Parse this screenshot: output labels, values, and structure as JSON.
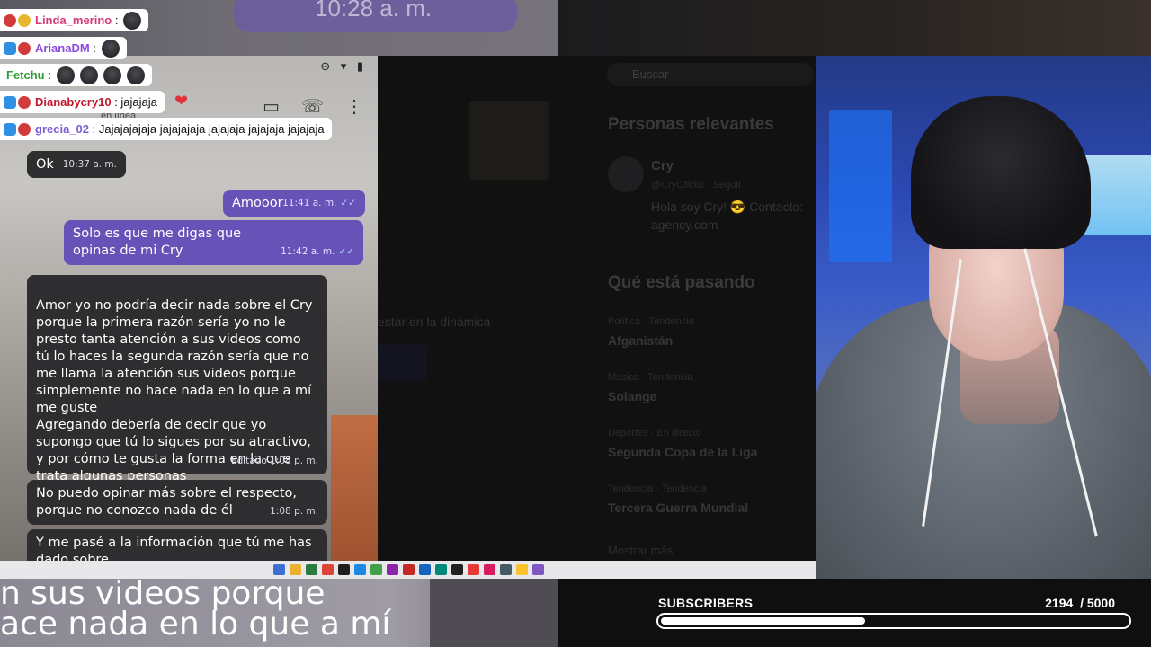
{
  "chat": [
    {
      "badges": [
        "red",
        "gold"
      ],
      "user": "Linda_merino",
      "color": "#d43a7a",
      "message": "",
      "emotes": 1
    },
    {
      "badges": [
        "blue",
        "red"
      ],
      "user": "ArianaDM",
      "color": "#8a4be0",
      "message": "",
      "emotes": 1
    },
    {
      "badges": [],
      "user": "Fetchu",
      "color": "#2e9d3a",
      "message": "",
      "emotes": 4
    },
    {
      "badges": [
        "blue",
        "red"
      ],
      "user": "Dianabycry10",
      "color": "#c0182e",
      "message": "jajajaja",
      "emotes": 0
    },
    {
      "badges": [
        "blue",
        "red"
      ],
      "user": "grecia_02",
      "color": "#7a5bd6",
      "message": "Jajajajajaja jajajajaja jajajaja jajajaja jajajaja",
      "emotes": 0
    }
  ],
  "phone": {
    "status_online": "en línea",
    "messages": [
      {
        "dir": "in",
        "text": "Ok",
        "time": "10:37 a. m."
      },
      {
        "dir": "out",
        "text": "Amooor",
        "time": "11:41 a. m."
      },
      {
        "dir": "out",
        "text": "Solo es que me digas que opinas de mi Cry",
        "time": "11:42 a. m."
      },
      {
        "dir": "in",
        "text": "Amor yo no podría decir  nada sobre el Cry porque la primera razón sería yo no le presto tanta atención a sus videos como tú lo haces la segunda razón sería que no me llama la atención sus videos porque simplemente no hace nada en lo que a mí me guste\nAgregando debería de decir que yo supongo que tú lo sigues por su atractivo, y por cómo te gusta la forma en la que trata algunas personas",
        "time": "Editado 1:08 p. m."
      },
      {
        "dir": "in",
        "text": "No puedo opinar más sobre el respecto, porque no conozco nada de él",
        "time": "1:08 p. m."
      },
      {
        "dir": "in",
        "text": "Y me pasé a  la información que tú me has dado sobre",
        "time": ""
      }
    ]
  },
  "twitter": {
    "search_placeholder": "Buscar",
    "relevant_title": "Personas relevantes",
    "person_name": "Cry",
    "person_handle": "@CryOficial · Seguir",
    "person_bio": "Hola soy Cry! 😎 Contacto: agency.com",
    "trending_title": "Qué está pasando",
    "trends": [
      {
        "meta": "Política · Tendencia",
        "name": "Afganistán"
      },
      {
        "meta": "Música · Tendencia",
        "name": "Solange"
      },
      {
        "meta": "Deportes · En directo",
        "name": "Segunda Copa de la Liga"
      },
      {
        "meta": "Tendencia · Tendencia",
        "name": "Tercera Guerra Mundial"
      }
    ],
    "show_more": "Mostrar más",
    "dynamic_text": "estar en la dinámica"
  },
  "background": {
    "top_text": "10:28 a. m.",
    "bottom_text_1": "n sus videos porque",
    "bottom_text_2": "ace nada en lo que a mí"
  },
  "subscribers": {
    "label": "SUBSCRIBERS",
    "current": 2194,
    "goal_text": "/ 5000",
    "progress": 0.4388
  },
  "taskbar_icon_colors": [
    "#3b6fd1",
    "#e9b12f",
    "#2b7a3f",
    "#db4437",
    "#1f1f1f",
    "#1e88e5",
    "#43a047",
    "#8e24aa",
    "#c62828",
    "#1565c0",
    "#00897b",
    "#212121",
    "#e53935",
    "#d81b60",
    "#455a64",
    "#fbc02d",
    "#7e57c2"
  ]
}
